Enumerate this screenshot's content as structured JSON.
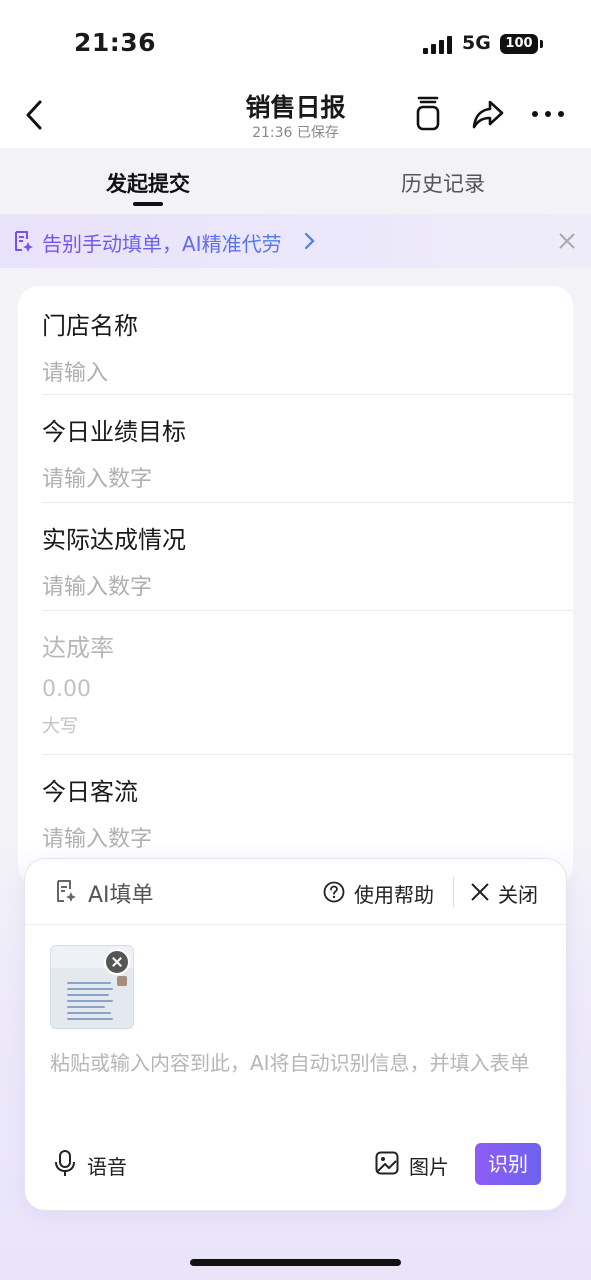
{
  "status_bar": {
    "time": "21:36",
    "network": "5G",
    "battery": "100"
  },
  "nav": {
    "title": "销售日报",
    "subtitle": "21:36 已保存"
  },
  "tabs": [
    {
      "label": "发起提交",
      "active": true
    },
    {
      "label": "历史记录",
      "active": false
    }
  ],
  "banner": {
    "text": "告别手动填单，AI精准代劳"
  },
  "form": {
    "fields": [
      {
        "label": "门店名称",
        "placeholder": "请输入"
      },
      {
        "label": "今日业绩目标",
        "placeholder": "请输入数字"
      },
      {
        "label": "实际达成情况",
        "placeholder": "请输入数字"
      },
      {
        "label": "达成率",
        "value": "0.00",
        "sub": "大写"
      },
      {
        "label": "今日客流",
        "placeholder": "请输入数字"
      }
    ]
  },
  "ai_panel": {
    "title": "AI填单",
    "help_label": "使用帮助",
    "close_label": "关闭",
    "placeholder": "粘贴或输入内容到此，AI将自动识别信息，并填入表单",
    "voice_label": "语音",
    "image_label": "图片",
    "recognize_label": "识别"
  },
  "colors": {
    "accent": "#7a4ef0",
    "accent_blue": "#4f7bf0",
    "background": "#f3f2f7"
  }
}
